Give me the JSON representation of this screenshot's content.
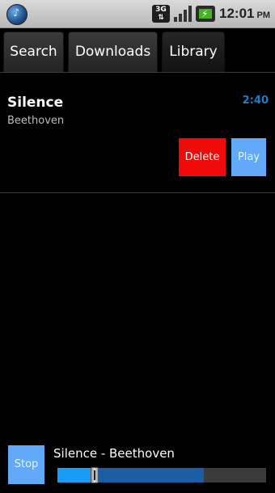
{
  "status_bar": {
    "app_icon": "music-note-icon",
    "network_label": "3G",
    "network_icon": "network-3g-icon",
    "signal_icon": "signal-strength-icon",
    "battery_icon": "battery-charging-icon",
    "time": "12:01",
    "ampm": "PM"
  },
  "tabs": [
    {
      "label": "Search",
      "selected": false
    },
    {
      "label": "Downloads",
      "selected": false
    },
    {
      "label": "Library",
      "selected": true
    }
  ],
  "library": {
    "items": [
      {
        "title": "Silence",
        "artist": "Beethoven",
        "duration": "2:40",
        "delete_label": "Delete",
        "play_label": "Play"
      }
    ]
  },
  "player": {
    "stop_label": "Stop",
    "now_playing": "Silence - Beethoven",
    "progress_played": 0.18,
    "progress_buffered": 0.7
  },
  "colors": {
    "delete": "#f10a0a",
    "action": "#62aaf9",
    "duration": "#1f7ec9",
    "progress_played": "#1a9cf4",
    "progress_buffered": "#1b5ea5"
  }
}
